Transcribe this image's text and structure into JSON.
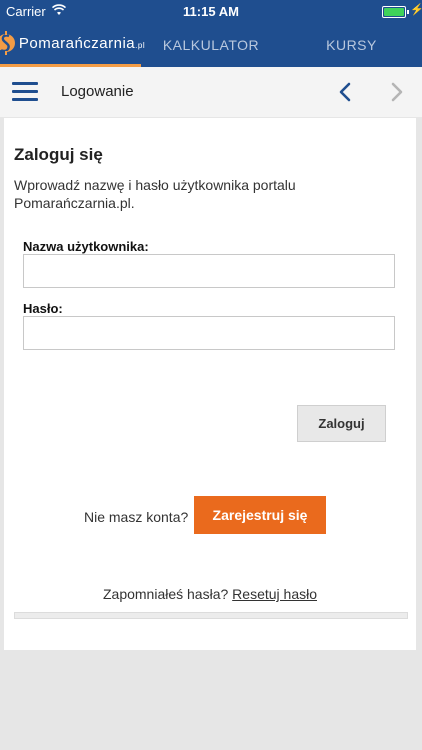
{
  "status_bar": {
    "carrier": "Carrier",
    "time": "11:15 AM",
    "icons": [
      "wifi-icon",
      "battery-icon",
      "charging-icon"
    ]
  },
  "tabs": {
    "logo_text": "Pomarańczarnia",
    "logo_suffix": ".pl",
    "items": [
      {
        "label": "KALKULATOR"
      },
      {
        "label": "KURSY"
      }
    ],
    "active_color": "#f39c45"
  },
  "header": {
    "title": "Logowanie",
    "icons": [
      "menu-icon",
      "back-icon",
      "forward-icon"
    ]
  },
  "login": {
    "heading": "Zaloguj się",
    "description": "Wprowadź nazwę i hasło użytkownika portalu Pomarańczarnia.pl.",
    "username_label": "Nazwa użytkownika:",
    "username_value": "",
    "password_label": "Hasło:",
    "password_value": "",
    "submit_label": "Zaloguj"
  },
  "register": {
    "prompt": "Nie masz konta?",
    "button_label": "Zarejestruj się"
  },
  "forgot": {
    "prompt": "Zapomniałeś hasła?",
    "link_label": "Resetuj hasło"
  },
  "colors": {
    "brand_blue": "#1f4e8f",
    "accent_orange": "#ea6a1d"
  }
}
